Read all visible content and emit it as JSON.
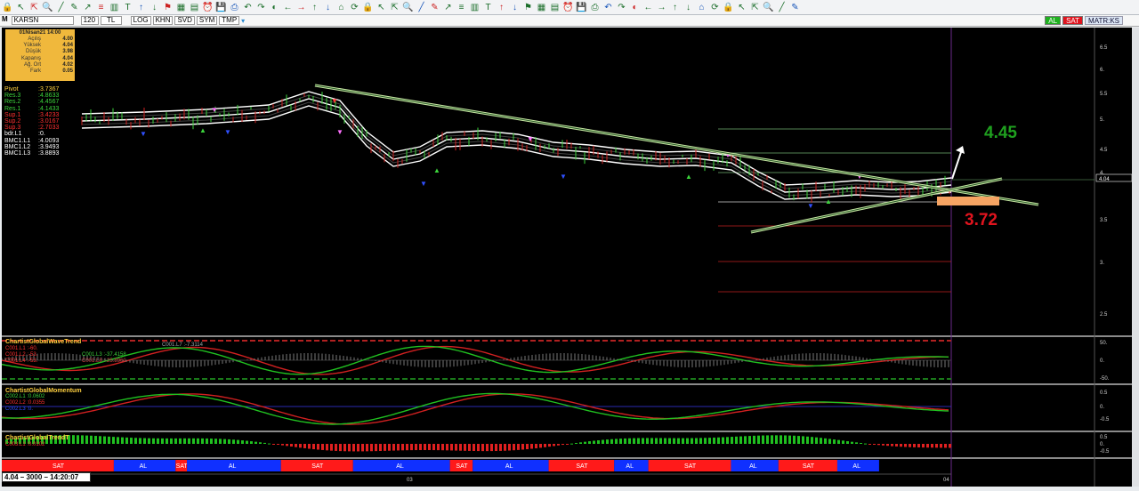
{
  "toolbar": {
    "icons": [
      "lock-icon",
      "arrow-icon",
      "cursor-icon",
      "zoom-icon",
      "line-icon",
      "pencil-icon",
      "trend-icon",
      "fib-icon",
      "channel-icon",
      "text-icon",
      "arrow-up-icon",
      "arrow-down-icon",
      "flag-icon",
      "grid-icon",
      "chart-icon",
      "bell-icon",
      "save-icon",
      "print-icon",
      "undo-icon",
      "redo-icon",
      "color-icon",
      "left-icon",
      "right-icon",
      "up-icon",
      "down-icon",
      "home-icon",
      "refresh-icon"
    ]
  },
  "subbar": {
    "symbol": "KARSN",
    "period": "120",
    "currency": "TL",
    "buttons": [
      "LOG",
      "KHN",
      "SVD",
      "SYM",
      "TMP"
    ]
  },
  "rightctl": {
    "al": "AL",
    "sat": "SAT",
    "matriks": "MATR:KS"
  },
  "info": {
    "date": "01Nisan21 14:00",
    "rows": [
      {
        "label": "Açılış",
        "value": "4.00"
      },
      {
        "label": "Yüksek",
        "value": "4.04"
      },
      {
        "label": "Düşük",
        "value": "3.98"
      },
      {
        "label": "Kapanış",
        "value": "4.04"
      },
      {
        "label": "Ağ. Ort",
        "value": "4.02"
      },
      {
        "label": "Fark",
        "value": "0.05"
      }
    ]
  },
  "pivot": [
    {
      "label": "Pivot",
      "value": ":3.7367",
      "color": "#ffd040"
    },
    {
      "label": "Res.3",
      "value": ":4.8633",
      "color": "#3cd43c"
    },
    {
      "label": "Res.2",
      "value": ":4.4567",
      "color": "#3cd43c"
    },
    {
      "label": "Res.1",
      "value": ":4.1433",
      "color": "#3cd43c"
    },
    {
      "label": "Sup.1",
      "value": ":3.4233",
      "color": "#ff3030"
    },
    {
      "label": "Sup.2",
      "value": ":3.0167",
      "color": "#ff3030"
    },
    {
      "label": "Sup.3",
      "value": ":2.7033",
      "color": "#ff3030"
    },
    {
      "label": "bdr.L1",
      "value": ":0.",
      "color": "#ffffff"
    },
    {
      "label": "BMC1.L1",
      "value": ":4.0093",
      "color": "#ffffff"
    },
    {
      "label": "BMC1.L2",
      "value": ":3.9493",
      "color": "#ffffff"
    },
    {
      "label": "BMC1.L3",
      "value": ":3.8893",
      "color": "#ffffff"
    }
  ],
  "annotations": {
    "target": "4.45",
    "stop": "3.72"
  },
  "price_axis": [
    "6.5",
    "6.",
    "5.5",
    "5.",
    "4.5",
    "4.",
    "4.04",
    "3.5",
    "3.",
    "2.5"
  ],
  "panels": [
    {
      "title": "ChartistGlobalWaveTrend",
      "legend": [
        {
          "label": "C001.L1",
          "value": ":-60."
        },
        {
          "label": "C001.L2",
          "value": ":-53."
        },
        {
          "label": "C001.L3",
          "value": ":-37.4158"
        },
        {
          "label": "C001.L4",
          "value": ":-53."
        },
        {
          "label": "C001.L7",
          "value": ":-7.3114"
        },
        {
          "label": "C001.L8",
          "value": ":-25.8960"
        }
      ],
      "axis": [
        "50.",
        "0.",
        "-50."
      ]
    },
    {
      "title": "ChartistGlobalMomentum",
      "legend": [
        {
          "label": "C002.L1",
          "value": ":0.0602"
        },
        {
          "label": "C002.L2",
          "value": ":0.0355"
        },
        {
          "label": "C002.L3",
          "value": ":0."
        }
      ],
      "axis": [
        "0.5",
        "0.",
        "-0.5"
      ]
    },
    {
      "title": "ChartistGlobalTrendT",
      "legend": [
        {
          "label": "C003.L1",
          "value": ":0.0102"
        }
      ],
      "axis": [
        "0.5",
        "0.",
        "-0.5"
      ]
    }
  ],
  "signals": [
    {
      "label": "SAT",
      "color": "#ff1a1a",
      "w": 0.118
    },
    {
      "label": "AL",
      "color": "#1030ff",
      "w": 0.065
    },
    {
      "label": "SAT",
      "color": "#ff1a1a",
      "w": 0.012
    },
    {
      "label": "AL",
      "color": "#1030ff",
      "w": 0.099
    },
    {
      "label": "SAT",
      "color": "#ff1a1a",
      "w": 0.076
    },
    {
      "label": "AL",
      "color": "#1030ff",
      "w": 0.102
    },
    {
      "label": "SAT",
      "color": "#ff1a1a",
      "w": 0.024
    },
    {
      "label": "AL",
      "color": "#1030ff",
      "w": 0.08
    },
    {
      "label": "SAT",
      "color": "#ff1a1a",
      "w": 0.069
    },
    {
      "label": "AL",
      "color": "#1030ff",
      "w": 0.036
    },
    {
      "label": "SAT",
      "color": "#ff1a1a",
      "w": 0.087
    },
    {
      "label": "AL",
      "color": "#1030ff",
      "w": 0.05
    },
    {
      "label": "SAT",
      "color": "#ff1a1a",
      "w": 0.062
    },
    {
      "label": "AL",
      "color": "#1030ff",
      "w": 0.044
    }
  ],
  "time_axis": [
    "03",
    "04"
  ],
  "status": "4.04 – 3000 – 14:20:07"
}
